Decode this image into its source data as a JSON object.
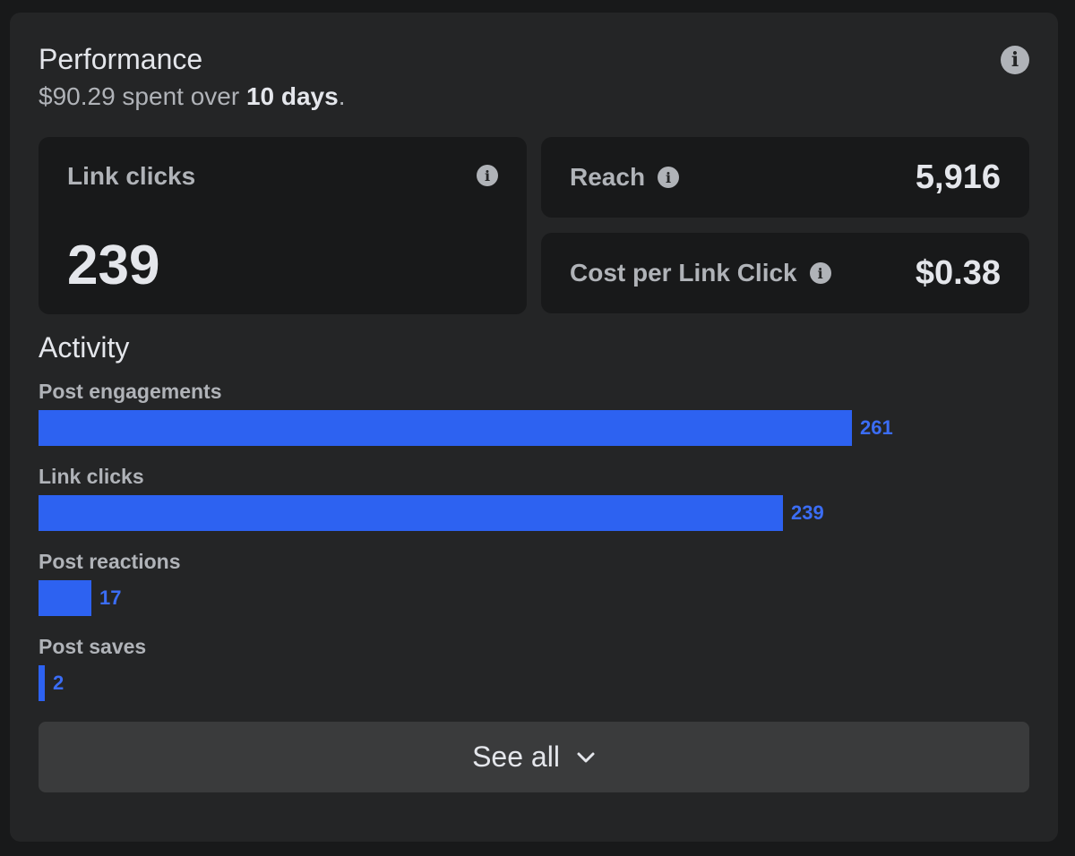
{
  "performance": {
    "title": "Performance",
    "spent": "$90.29",
    "spent_middle": " spent over ",
    "duration": "10 days",
    "suffix": "."
  },
  "metrics": {
    "link_clicks": {
      "label": "Link clicks",
      "value": "239"
    },
    "reach": {
      "label": "Reach",
      "value": "5,916"
    },
    "cost_per_click": {
      "label": "Cost per Link Click",
      "value": "$0.38"
    }
  },
  "activity": {
    "title": "Activity",
    "items": [
      {
        "label": "Post engagements",
        "value": "261",
        "count": 261
      },
      {
        "label": "Link clicks",
        "value": "239",
        "count": 239
      },
      {
        "label": "Post reactions",
        "value": "17",
        "count": 17
      },
      {
        "label": "Post saves",
        "value": "2",
        "count": 2
      }
    ]
  },
  "see_all_label": "See all",
  "colors": {
    "bar": "#2d62f1",
    "bar_label": "#3b6df5",
    "card": "#242526"
  },
  "icons": {
    "info": "info-circle-icon",
    "chevron": "chevron-down-icon"
  }
}
